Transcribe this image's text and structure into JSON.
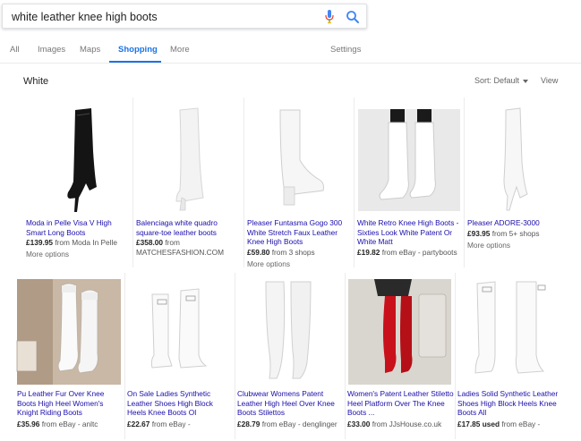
{
  "search": {
    "query": "white leather knee high boots"
  },
  "tabs": [
    {
      "label": "All"
    },
    {
      "label": "Images"
    },
    {
      "label": "Maps"
    },
    {
      "label": "Shopping"
    },
    {
      "label": "More"
    }
  ],
  "settings_label": "Settings",
  "section": {
    "title": "White",
    "sort_label": "Sort:",
    "sort_value": "Default",
    "view_label": "View"
  },
  "products_row1": [
    {
      "title": "Moda in Pelle Visa V High Smart Long Boots",
      "price": "£139.95",
      "source": "from Moda In Pelle",
      "more": "More options"
    },
    {
      "title": "Balenciaga white quadro square-toe leather boots",
      "price": "£358.00",
      "source": "from",
      "source2": "MATCHESFASHION.COM"
    },
    {
      "title": "Pleaser Funtasma Gogo 300 White Stretch Faux Leather Knee High Boots",
      "price": "£59.80",
      "source": "from 3 shops",
      "more": "More options"
    },
    {
      "title": "White Retro Knee High Boots - Sixties Look White Patent Or White Matt",
      "price": "£19.82",
      "source": "from eBay - partyboots"
    },
    {
      "title": "Pleaser ADORE-3000",
      "price": "£93.95",
      "source": "from 5+ shops",
      "more": "More options"
    }
  ],
  "products_row2": [
    {
      "title": "Pu Leather Fur Over Knee Boots High Heel Women's Knight Riding Boots",
      "price": "£35.96",
      "source": "from eBay - anltc"
    },
    {
      "title": "On Sale Ladies Synthetic Leather Shoes High Block Heels Knee Boots OI",
      "price": "£22.67",
      "source": "from eBay -"
    },
    {
      "title": "Clubwear Womens Patent Leather High Heel Over Knee Boots Stilettos",
      "price": "£28.79",
      "source": "from eBay - denglinger"
    },
    {
      "title": "Women's Patent Leather Stiletto Heel Platform Over The Knee Boots ...",
      "price": "£33.00",
      "source": "from JJsHouse.co.uk"
    },
    {
      "title": "Ladies Solid Synthetic Leather Shoes High Block Heels Knee Boots All",
      "price": "£17.85",
      "price_suffix": "used",
      "source": "from eBay -"
    }
  ],
  "colors": {
    "accent": "#1a73e8",
    "link": "#1a0dab",
    "boot_red": "#c8111b"
  }
}
